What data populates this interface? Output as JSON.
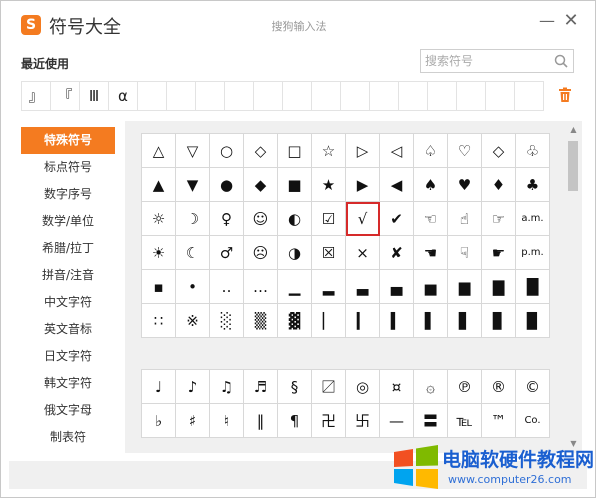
{
  "window": {
    "app_title": "符号大全",
    "center_title": "搜狗输入法",
    "logo_letter": "S",
    "minimize_glyph": "—",
    "close_glyph": "✕"
  },
  "recent": {
    "label": "最近使用",
    "symbols": [
      "』",
      "『",
      "Ⅲ",
      "α",
      "",
      "",
      "",
      "",
      "",
      "",
      "",
      "",
      "",
      "",
      "",
      "",
      "",
      ""
    ]
  },
  "search": {
    "placeholder": "搜索符号"
  },
  "sidebar": {
    "items": [
      {
        "label": "特殊符号",
        "active": true
      },
      {
        "label": "标点符号"
      },
      {
        "label": "数字序号"
      },
      {
        "label": "数学/单位"
      },
      {
        "label": "希腊/拉丁"
      },
      {
        "label": "拼音/注音"
      },
      {
        "label": "中文字符"
      },
      {
        "label": "英文音标"
      },
      {
        "label": "日文字符"
      },
      {
        "label": "韩文字符"
      },
      {
        "label": "俄文字母"
      },
      {
        "label": "制表符"
      }
    ]
  },
  "symbols_group1": [
    "△",
    "▽",
    "○",
    "◇",
    "□",
    "☆",
    "▷",
    "◁",
    "♤",
    "♡",
    "◇",
    "♧",
    "▲",
    "▼",
    "●",
    "◆",
    "■",
    "★",
    "▶",
    "◀",
    "♠",
    "♥",
    "♦",
    "♣",
    "☼",
    "☽",
    "♀",
    "☺",
    "◐",
    "☑",
    "√",
    "✔",
    "☜",
    "☝",
    "☞",
    "a.m.",
    "☀",
    "☾",
    "♂",
    "☹",
    "◑",
    "☒",
    "×",
    "✘",
    "☚",
    "☟",
    "☛",
    "p.m.",
    "▪",
    "•",
    "‥",
    "…",
    "▁",
    "▂",
    "▃",
    "▄",
    "▅",
    "▆",
    "▇",
    "█",
    "∷",
    "※",
    "░",
    "▒",
    "▓",
    "▏",
    "▎",
    "▍",
    "▌",
    "▋",
    "▊",
    "▉"
  ],
  "selected_symbol": "√",
  "symbols_group2": [
    "♩",
    "♪",
    "♫",
    "♬",
    "§",
    "〼",
    "◎",
    "¤",
    "۞",
    "℗",
    "®",
    "©",
    "♭",
    "♯",
    "♮",
    "‖",
    "¶",
    "卍",
    "卐",
    "—",
    "〓",
    "℡",
    "™",
    "Co."
  ],
  "watermark": {
    "text": "电脑软硬件教程网",
    "url": "www.computer26.com"
  }
}
